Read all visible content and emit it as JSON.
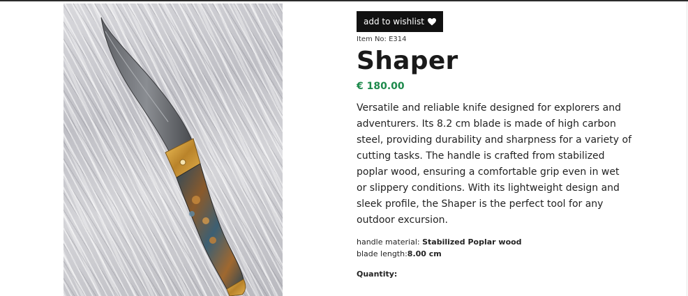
{
  "product": {
    "wishlist_label": "add to wishlist",
    "item_no": "Item No: E314",
    "title": "Shaper",
    "price": "€ 180.00",
    "description": "Versatile and reliable knife designed for explorers and adventurers. Its 8.2 cm blade is made of high carbon steel, providing durability and sharpness for a variety of cutting tasks. The handle is crafted from stabilized poplar wood, ensuring a comfortable grip even in wet or slippery conditions. With its lightweight design and sleek profile, the Shaper is the perfect tool for any outdoor excursion.",
    "specs": [
      {
        "label": "handle material: ",
        "value": "Stabilized Poplar wood"
      },
      {
        "label": "blade length:",
        "value": "8.00 cm"
      }
    ],
    "quantity_label": "Quantity:"
  },
  "icons": {
    "wishlist": "heart-icon"
  },
  "colors": {
    "price": "#1e8a4c",
    "button_bg": "#111111",
    "button_text": "#ffffff"
  }
}
